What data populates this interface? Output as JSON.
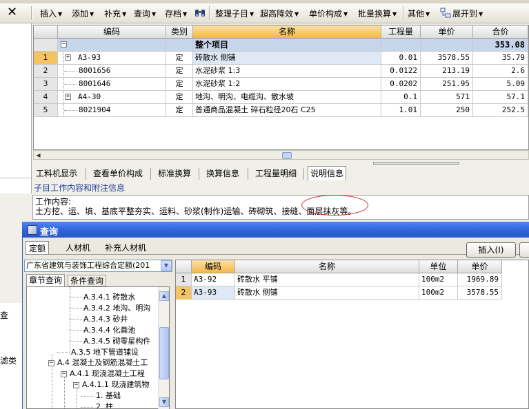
{
  "window": {
    "close_glyph": "✕"
  },
  "toolbar": {
    "items": [
      {
        "label": "插入",
        "name": "insert-menu"
      },
      {
        "label": "添加",
        "name": "add-menu"
      },
      {
        "label": "补充",
        "name": "supplement-menu"
      },
      {
        "label": "查询",
        "name": "query-menu"
      },
      {
        "label": "存档",
        "name": "archive-menu"
      },
      {
        "label": "整理子目",
        "name": "organize-items-menu"
      },
      {
        "label": "超高降效",
        "name": "super-high-menu"
      },
      {
        "label": "单价构成",
        "name": "unit-price-composition-menu"
      },
      {
        "label": "批量换算",
        "name": "batch-conversion-menu"
      },
      {
        "label": "其他",
        "name": "other-menu"
      },
      {
        "label": "展开到",
        "name": "expand-to-menu"
      }
    ]
  },
  "left_panel": {
    "fragment_1": "查",
    "fragment_2": "滤类"
  },
  "main_grid": {
    "headers": [
      "",
      "编码",
      "类别",
      "名称",
      "工程量",
      "单价",
      "合价"
    ],
    "summary_row": {
      "tree": "−",
      "name": "整个项目",
      "total": "353.08"
    },
    "rows": [
      {
        "no": "1",
        "tree": "+",
        "code": "A3-93",
        "type": "定",
        "name": "砖散水 侧铺",
        "qty": "0.01",
        "price": "3578.55",
        "total": "35.79"
      },
      {
        "no": "2",
        "tree": "",
        "code": "8001656",
        "type": "定",
        "name": "水泥砂浆 1:3",
        "qty": "0.0122",
        "price": "213.19",
        "total": "2.6"
      },
      {
        "no": "3",
        "tree": "",
        "code": "8001646",
        "type": "定",
        "name": "水泥砂浆 1:2",
        "qty": "0.0202",
        "price": "251.95",
        "total": "5.09"
      },
      {
        "no": "4",
        "tree": "+",
        "code": "A4-30",
        "type": "定",
        "name": "地沟、明沟、电缆沟、散水坡",
        "qty": "0.1",
        "price": "571",
        "total": "57.1"
      },
      {
        "no": "5",
        "tree": "",
        "code": "8021904",
        "type": "定",
        "name": "普通商品混凝土 碎石粒径20石 C25",
        "qty": "1.01",
        "price": "250",
        "total": "252.5"
      }
    ]
  },
  "bottom_tabs": {
    "items": [
      "工料机显示",
      "查看单价构成",
      "标准换算",
      "换算信息",
      "工程量明细",
      "说明信息"
    ],
    "active": "说明信息"
  },
  "info": {
    "subtitle": "子目工作内容和附注信息",
    "line1": "工作内容:",
    "line2": "土方挖、运、填、基底平整夯实、运料、砂浆(制作)运输、砖砌筑、接缝、面层抹灰等。"
  },
  "dialog": {
    "title": "查询",
    "tabs": [
      "定额",
      "人材机",
      "补充人材机"
    ],
    "active_tab": "定额",
    "insert_button": "插入(I)",
    "library": "广东省建筑与装饰工程综合定额(201",
    "search_tabs": [
      "章节查询",
      "条件查询"
    ],
    "tree": [
      {
        "label": "A.3.4.1 砖散水",
        "selected": true
      },
      {
        "label": "A.3.4.2 地沟、明沟"
      },
      {
        "label": "A.3.4.3 砂井"
      },
      {
        "label": "A.3.4.4 化粪池"
      },
      {
        "label": "A.3.4.5 砌零星构件"
      },
      {
        "label": "A.3.5 地下管道铺设"
      },
      {
        "label": "A.4 混凝土及钢筋混凝土工"
      },
      {
        "label": "A.4.1 现浇混凝土工程"
      },
      {
        "label": "A.4.1.1 现浇建筑物"
      },
      {
        "label": "1. 基础"
      },
      {
        "label": "2. 柱"
      }
    ],
    "result_headers": [
      "",
      "编码",
      "名称",
      "单位",
      "单价"
    ],
    "results": [
      {
        "no": "1",
        "code": "A3-92",
        "name": "砖散水 平铺",
        "unit": "100m2",
        "price": "1969.89"
      },
      {
        "no": "2",
        "code": "A3-93",
        "name": "砖散水 侧铺",
        "unit": "100m2",
        "price": "3578.55"
      }
    ]
  }
}
